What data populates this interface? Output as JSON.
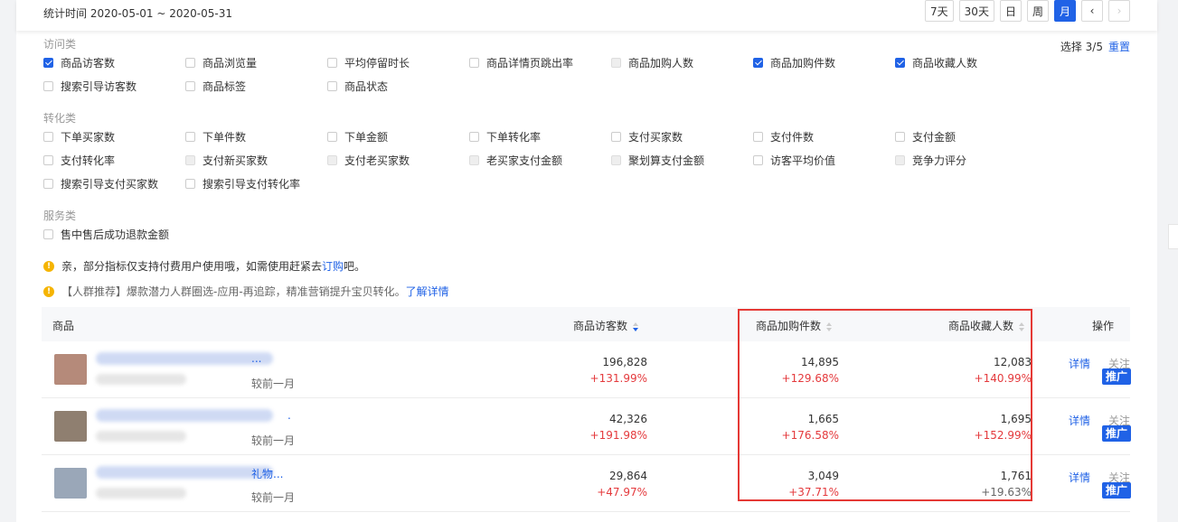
{
  "header": {
    "stat_time": "统计时间 2020-05-01 ~ 2020-05-31",
    "periods": [
      {
        "label": "7天",
        "active": false
      },
      {
        "label": "30天",
        "active": false
      },
      {
        "label": "日",
        "active": false
      },
      {
        "label": "周",
        "active": false
      },
      {
        "label": "月",
        "active": true
      }
    ],
    "prev": "‹",
    "next": "›"
  },
  "selection": {
    "count": "选择 3/5",
    "reset": "重置"
  },
  "groups": {
    "visit": {
      "title": "访问类",
      "items": [
        {
          "label": "商品访客数",
          "state": "checked"
        },
        {
          "label": "商品浏览量",
          "state": "unchecked"
        },
        {
          "label": "平均停留时长",
          "state": "unchecked"
        },
        {
          "label": "商品详情页跳出率",
          "state": "unchecked"
        },
        {
          "label": "商品加购人数",
          "state": "disabled"
        },
        {
          "label": "商品加购件数",
          "state": "checked"
        },
        {
          "label": "商品收藏人数",
          "state": "checked"
        },
        {
          "label": "搜索引导访客数",
          "state": "unchecked"
        },
        {
          "label": "商品标签",
          "state": "unchecked"
        },
        {
          "label": "商品状态",
          "state": "unchecked"
        }
      ]
    },
    "convert": {
      "title": "转化类",
      "items": [
        {
          "label": "下单买家数",
          "state": "unchecked"
        },
        {
          "label": "下单件数",
          "state": "unchecked"
        },
        {
          "label": "下单金额",
          "state": "unchecked"
        },
        {
          "label": "下单转化率",
          "state": "unchecked"
        },
        {
          "label": "支付买家数",
          "state": "unchecked"
        },
        {
          "label": "支付件数",
          "state": "unchecked"
        },
        {
          "label": "支付金额",
          "state": "unchecked"
        },
        {
          "label": "支付转化率",
          "state": "unchecked"
        },
        {
          "label": "支付新买家数",
          "state": "disabled"
        },
        {
          "label": "支付老买家数",
          "state": "disabled"
        },
        {
          "label": "老买家支付金额",
          "state": "disabled"
        },
        {
          "label": "聚划算支付金额",
          "state": "disabled"
        },
        {
          "label": "访客平均价值",
          "state": "unchecked"
        },
        {
          "label": "竞争力评分",
          "state": "disabled"
        },
        {
          "label": "搜索引导支付买家数",
          "state": "unchecked"
        },
        {
          "label": "搜索引导支付转化率",
          "state": "unchecked"
        }
      ]
    },
    "service": {
      "title": "服务类",
      "items": [
        {
          "label": "售中售后成功退款金额",
          "state": "unchecked"
        }
      ]
    }
  },
  "notices": {
    "paid": {
      "text": "亲，部分指标仅支持付费用户使用哦，如需使用赶紧去",
      "link": "订购",
      "suffix": "吧。"
    },
    "crowd": {
      "text": "【人群推荐】爆款潜力人群圈选-应用-再追踪，精准营销提升宝贝转化。",
      "link": "了解详情"
    }
  },
  "table": {
    "headers": {
      "product": "商品",
      "visitors": "商品访客数",
      "cart_items": "商品加购件数",
      "favorites": "商品收藏人数",
      "actions": "操作"
    },
    "rows": [
      {
        "title_tail": "...",
        "compare": "较前一月",
        "visitors": "196,828",
        "visitors_chg": "+131.99%",
        "cart": "14,895",
        "cart_chg": "+129.68%",
        "fav": "12,083",
        "fav_chg": "+140.99%",
        "detail": "详情",
        "follow": "关注",
        "promote": "推广"
      },
      {
        "title_tail": ".",
        "compare": "较前一月",
        "visitors": "42,326",
        "visitors_chg": "+191.98%",
        "cart": "1,665",
        "cart_chg": "+176.58%",
        "fav": "1,695",
        "fav_chg": "+152.99%",
        "detail": "详情",
        "follow": "关注",
        "promote": "推广"
      },
      {
        "title_tail": "礼物...",
        "compare": "较前一月",
        "visitors": "29,864",
        "visitors_chg": "+47.97%",
        "cart": "3,049",
        "cart_chg": "+37.71%",
        "fav": "1,761",
        "fav_chg": "+19.63%",
        "detail": "详情",
        "follow": "关注",
        "promote": "推广"
      }
    ]
  },
  "colors": {
    "accent": "#2062e6",
    "increase": "#e4393c",
    "highlight": "#e53935",
    "warning": "#f5b400"
  }
}
